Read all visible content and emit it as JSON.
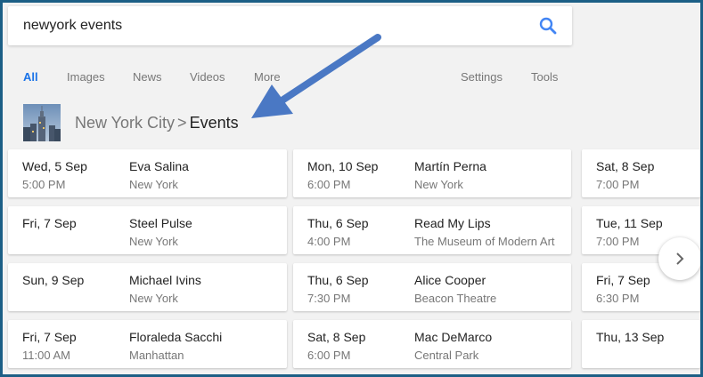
{
  "search": {
    "query": "newyork events"
  },
  "tabs": [
    {
      "label": "All",
      "active": true
    },
    {
      "label": "Images"
    },
    {
      "label": "News"
    },
    {
      "label": "Videos"
    },
    {
      "label": "More"
    },
    {
      "label": "Settings"
    },
    {
      "label": "Tools"
    }
  ],
  "breadcrumb": {
    "parent": "New York City",
    "separator": ">",
    "current": "Events"
  },
  "columns": [
    [
      {
        "date": "Wed, 5 Sep",
        "time": "5:00 PM",
        "artist": "Eva Salina",
        "venue": "New York"
      },
      {
        "date": "Fri, 7 Sep",
        "time": "",
        "artist": "Steel Pulse",
        "venue": "New York"
      },
      {
        "date": "Sun, 9 Sep",
        "time": "",
        "artist": "Michael Ivins",
        "venue": "New York"
      },
      {
        "date": "Fri, 7 Sep",
        "time": "11:00 AM",
        "artist": "Floraleda Sacchi",
        "venue": "Manhattan"
      }
    ],
    [
      {
        "date": "Mon, 10 Sep",
        "time": "6:00 PM",
        "artist": "Martín Perna",
        "venue": "New York"
      },
      {
        "date": "Thu, 6 Sep",
        "time": "4:00 PM",
        "artist": "Read My Lips",
        "venue": "The Museum of Modern Art"
      },
      {
        "date": "Thu, 6 Sep",
        "time": "7:30 PM",
        "artist": "Alice Cooper",
        "venue": "Beacon Theatre"
      },
      {
        "date": "Sat, 8 Sep",
        "time": "6:00 PM",
        "artist": "Mac DeMarco",
        "venue": "Central Park"
      }
    ],
    [
      {
        "date": "Sat, 8 Sep",
        "time": "7:00 PM"
      },
      {
        "date": "Tue, 11 Sep",
        "time": "7:00 PM"
      },
      {
        "date": "Fri, 7 Sep",
        "time": "6:30 PM"
      },
      {
        "date": "Thu, 13 Sep",
        "time": ""
      }
    ]
  ],
  "colors": {
    "accent": "#1a73e8",
    "frame": "#1c5f86",
    "annotation_arrow": "#4a78c4"
  }
}
